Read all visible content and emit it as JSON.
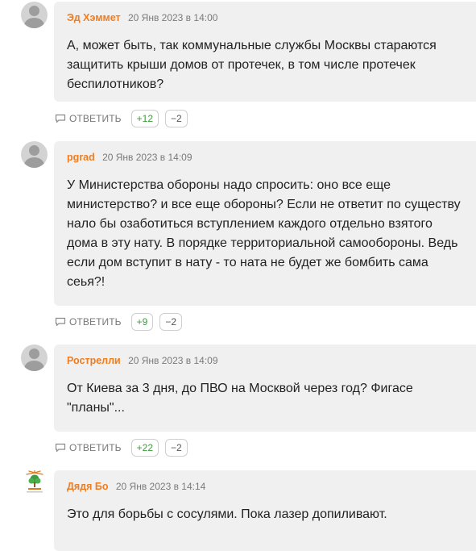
{
  "comments": [
    {
      "author": "Эд Хэммет",
      "time": "20 Янв 2023 в 14:00",
      "lines": [
        "А, может быть, так коммунальные службы Москвы стараются",
        "защитить крыши домов от протечек, в том числе протечек",
        "беспилотников?"
      ],
      "reply_label": "ОТВЕТИТЬ",
      "upvotes": "+12",
      "downvotes": "−2"
    },
    {
      "author": "pgrad",
      "time": "20 Янв 2023 в 14:09",
      "lines": [
        "У Министерства обороны надо спросить: оно все еще",
        "министерство? и все еще обороны? Если не ответит по существу",
        "нало бы озаботиться вступлением каждого отдельно взятого",
        "дома в эту нату. В порядке территориальной самообороны. Ведь",
        "если дом вступит в нату - то ната не будет же бомбить сама",
        "сеья?!"
      ],
      "reply_label": "ОТВЕТИТЬ",
      "upvotes": "+9",
      "downvotes": "−2"
    },
    {
      "author": "Рострелли",
      "time": "20 Янв 2023 в 14:09",
      "lines": [
        "От Киева за 3 дня, до ПВО на Москвой через год? Фигасе",
        "\"планы\"..."
      ],
      "reply_label": "ОТВЕТИТЬ",
      "upvotes": "+22",
      "downvotes": "−2"
    },
    {
      "author": "Дядя Бо",
      "time": "20 Янв 2023 в 14:14",
      "lines": [
        "Это для борьбы с сосулями. Пока лазер допиливают."
      ]
    }
  ],
  "colors": {
    "author": "#ee7d22",
    "upvote": "#3d9c3d",
    "bubble": "#f0f0f0"
  },
  "icons": {
    "reply": "speech-bubble-icon",
    "avatar_default": "user-silhouette-icon",
    "avatar_logo": "tree-logo-icon"
  }
}
